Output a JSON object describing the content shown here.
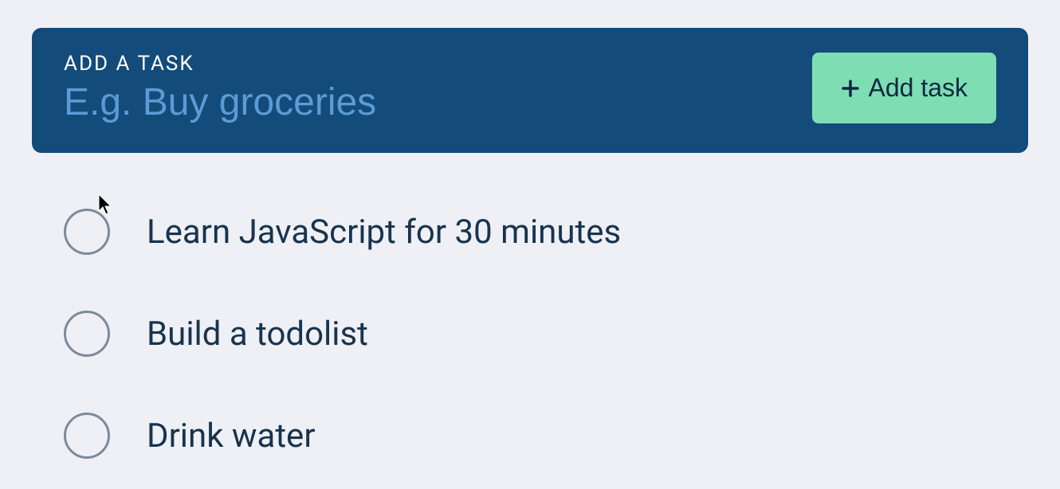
{
  "input": {
    "label": "Add a task",
    "placeholder": "E.g. Buy groceries"
  },
  "button": {
    "label": "Add task"
  },
  "tasks": [
    {
      "text": "Learn JavaScript for 30 minutes",
      "completed": false
    },
    {
      "text": "Build a todolist",
      "completed": false
    },
    {
      "text": "Drink water",
      "completed": false
    }
  ]
}
